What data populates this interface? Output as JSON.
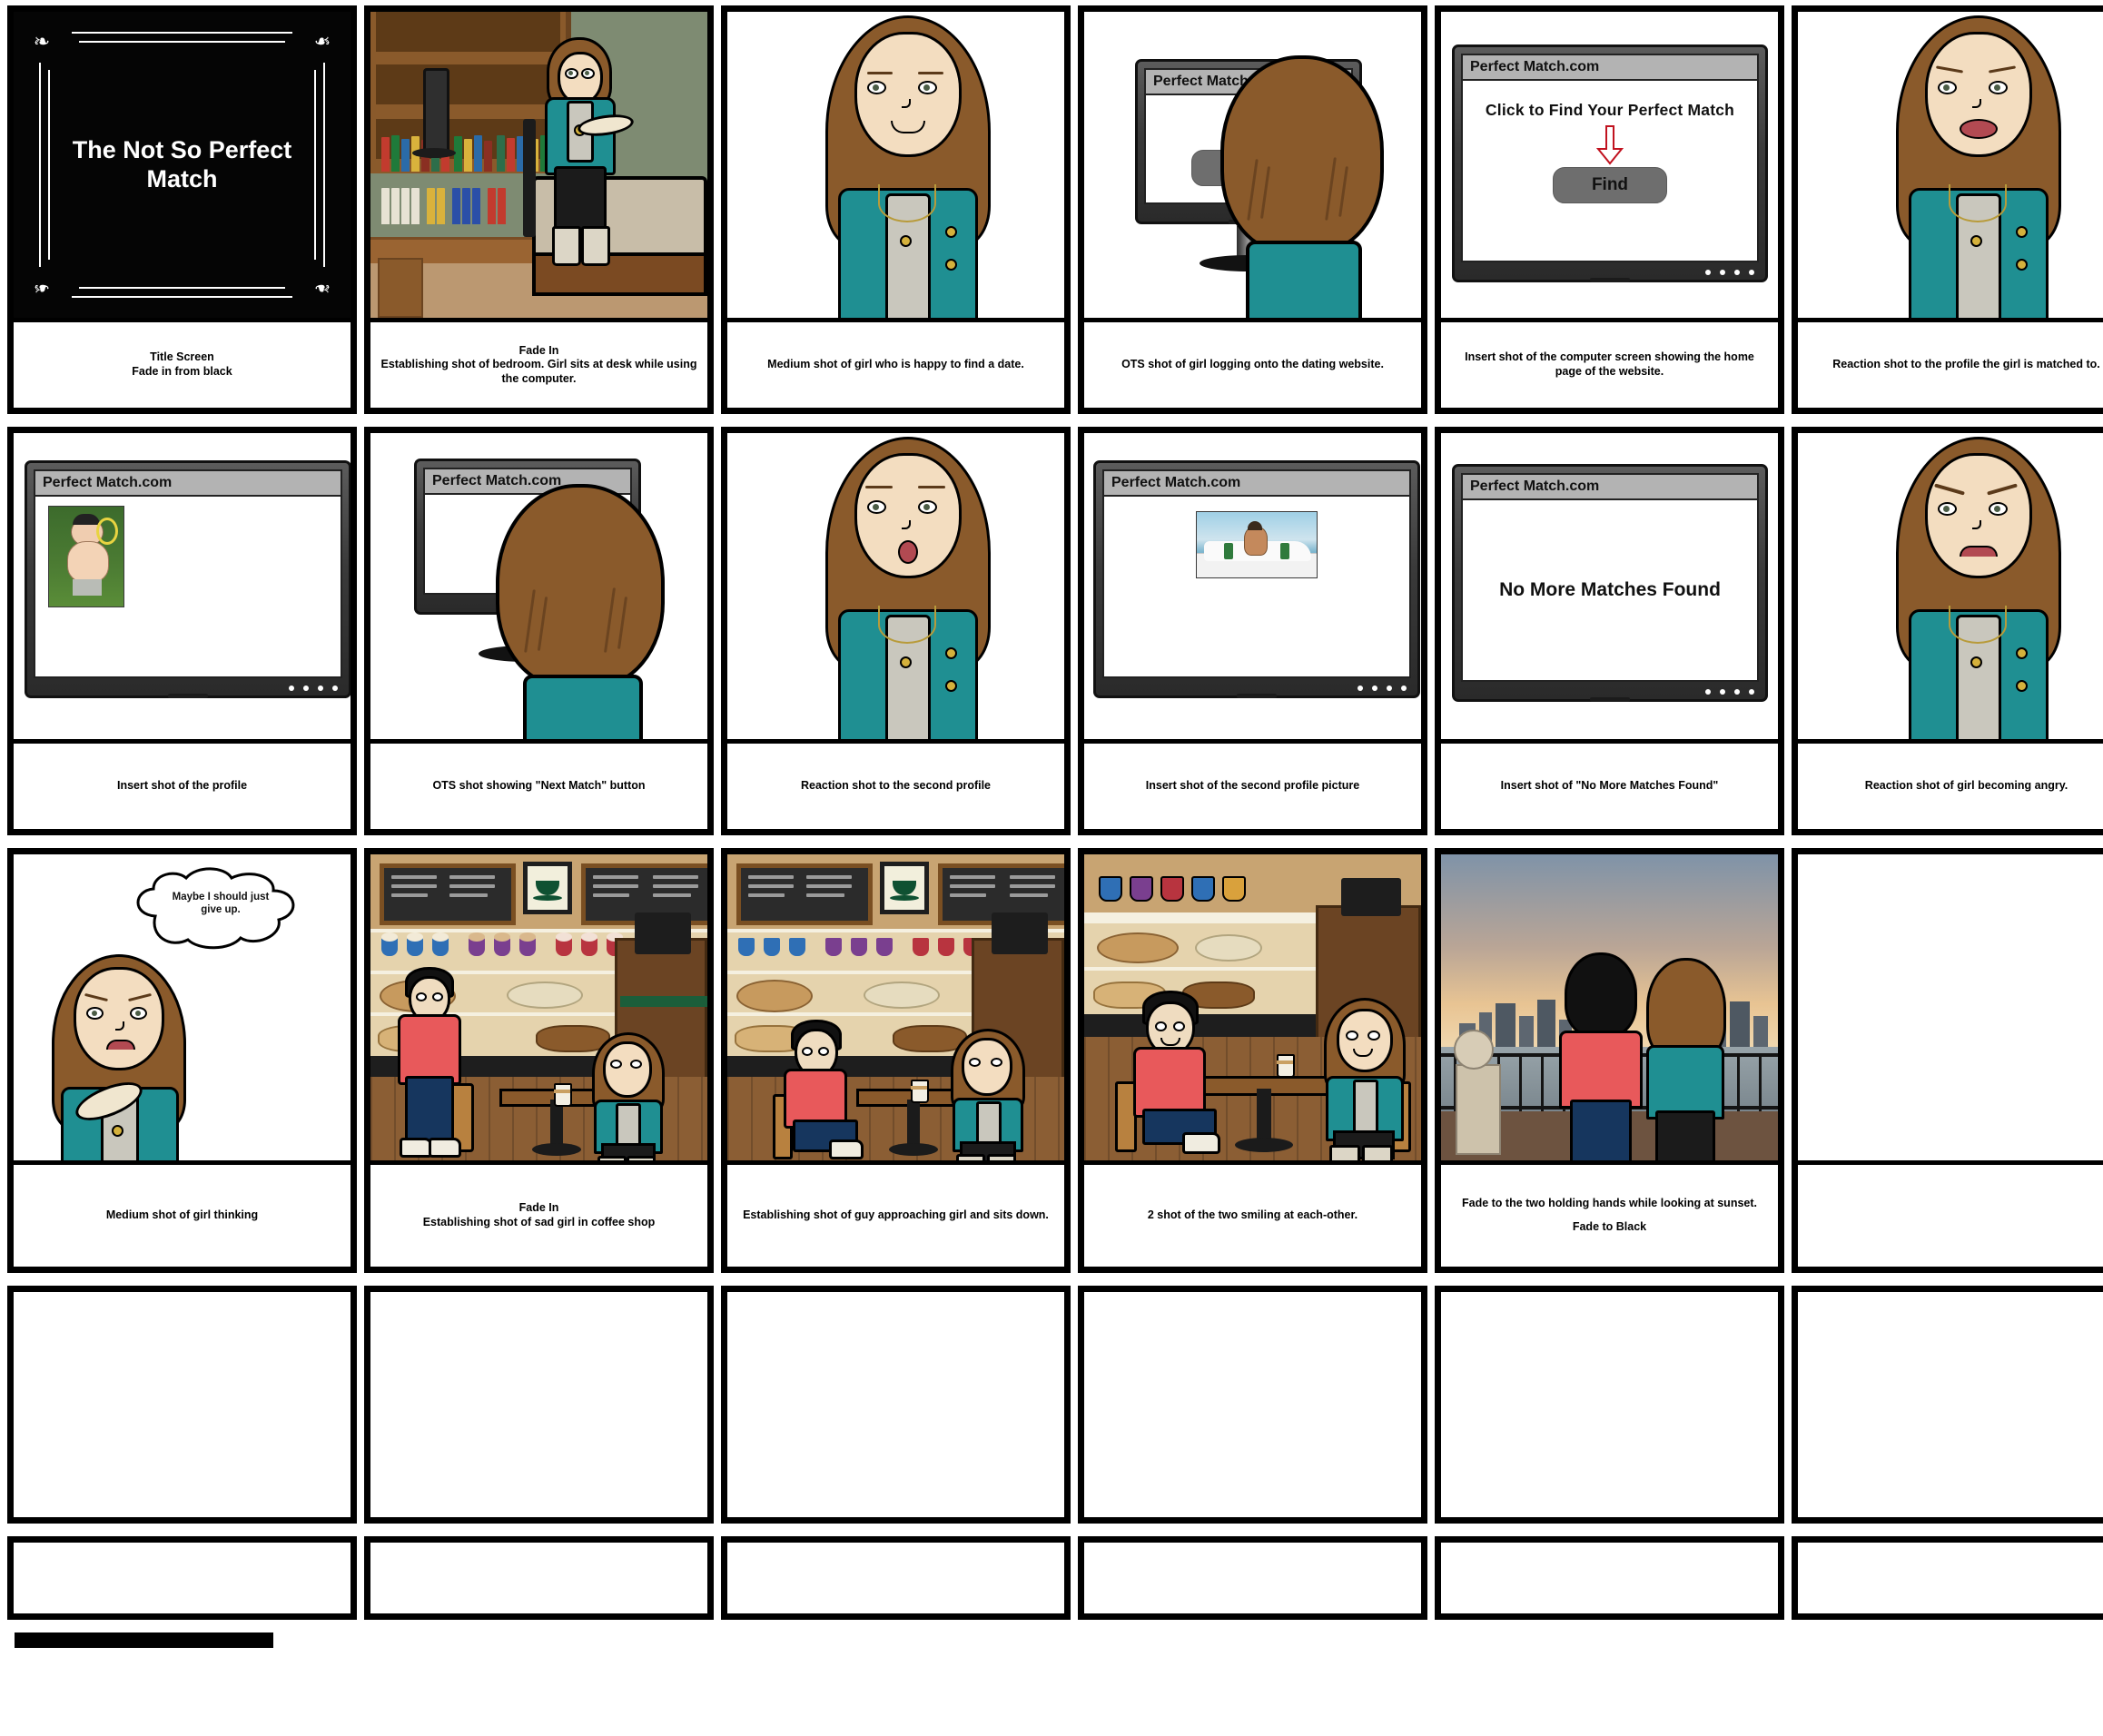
{
  "document": {
    "title": "The Not So Perfect Match",
    "type": "storyboard",
    "columns": 6,
    "rows": 5
  },
  "title_card": {
    "text": "The Not So Perfect Match",
    "background": "#050505",
    "text_color": "#ffffff",
    "corner_ornament": "❧"
  },
  "website": {
    "name": "Perfect Match.com",
    "home_headline": "Click to Find Your Perfect Match",
    "find_button": "Find",
    "no_match_message": "No More Matches Found",
    "titlebar_color": "#b3b3b3",
    "arrow_color": "#c1121f"
  },
  "thought_bubble": {
    "line1": "Maybe I should just",
    "line2": "give up."
  },
  "cells": [
    {
      "id": "r1c1",
      "art": "title-card",
      "caption": [
        "Title Screen",
        "Fade in from black"
      ]
    },
    {
      "id": "r1c2",
      "art": "bedroom-desk",
      "caption": [
        "Fade In",
        "Establishing shot of bedroom. Girl sits at desk while using the computer."
      ]
    },
    {
      "id": "r1c3",
      "art": "girl-happy",
      "caption": [
        "Medium shot of girl who is happy to find a date."
      ]
    },
    {
      "id": "r1c4",
      "art": "ots-login",
      "caption": [
        "OTS shot of girl logging onto the dating website."
      ]
    },
    {
      "id": "r1c5",
      "art": "monitor-home",
      "caption": [
        "Insert shot of the computer screen showing the home page of the website."
      ]
    },
    {
      "id": "r1c6",
      "art": "girl-disgusted",
      "caption": [
        "Reaction shot to the profile the girl is matched to."
      ]
    },
    {
      "id": "r2c1",
      "art": "monitor-profile1",
      "caption": [
        "Insert shot of the profile"
      ]
    },
    {
      "id": "r2c2",
      "art": "ots-next-match",
      "caption": [
        "OTS shot showing \"Next Match\" button"
      ]
    },
    {
      "id": "r2c3",
      "art": "girl-surprised",
      "caption": [
        "Reaction shot to the second profile"
      ]
    },
    {
      "id": "r2c4",
      "art": "monitor-profile2",
      "caption": [
        "Insert shot of the second profile picture"
      ]
    },
    {
      "id": "r2c5",
      "art": "monitor-nomatch",
      "caption": [
        "Insert shot of \"No More Matches Found\""
      ]
    },
    {
      "id": "r2c6",
      "art": "girl-angry",
      "caption": [
        "Reaction shot of girl becoming angry."
      ]
    },
    {
      "id": "r3c1",
      "art": "girl-thinking",
      "caption": [
        "Medium shot of girl thinking"
      ]
    },
    {
      "id": "r3c2",
      "art": "coffeeshop-standing",
      "caption": [
        "Fade In",
        "Establishing shot of sad girl in coffee shop"
      ]
    },
    {
      "id": "r3c3",
      "art": "coffeeshop-sitting",
      "caption": [
        "Establishing shot of guy approaching girl and sits down."
      ]
    },
    {
      "id": "r3c4",
      "art": "coffeeshop-smiling",
      "caption": [
        "2 shot of the two smiling at each-other."
      ]
    },
    {
      "id": "r3c5",
      "art": "sunset-couple",
      "caption": [
        "Fade to the two holding hands while looking at sunset.",
        "",
        "Fade to Black"
      ]
    },
    {
      "id": "r3c6",
      "art": "empty",
      "caption": []
    },
    {
      "id": "r4c1",
      "art": "empty",
      "caption": []
    },
    {
      "id": "r4c2",
      "art": "empty",
      "caption": []
    },
    {
      "id": "r4c3",
      "art": "empty",
      "caption": []
    },
    {
      "id": "r4c4",
      "art": "empty",
      "caption": []
    },
    {
      "id": "r4c5",
      "art": "empty",
      "caption": []
    },
    {
      "id": "r4c6",
      "art": "empty",
      "caption": []
    }
  ]
}
